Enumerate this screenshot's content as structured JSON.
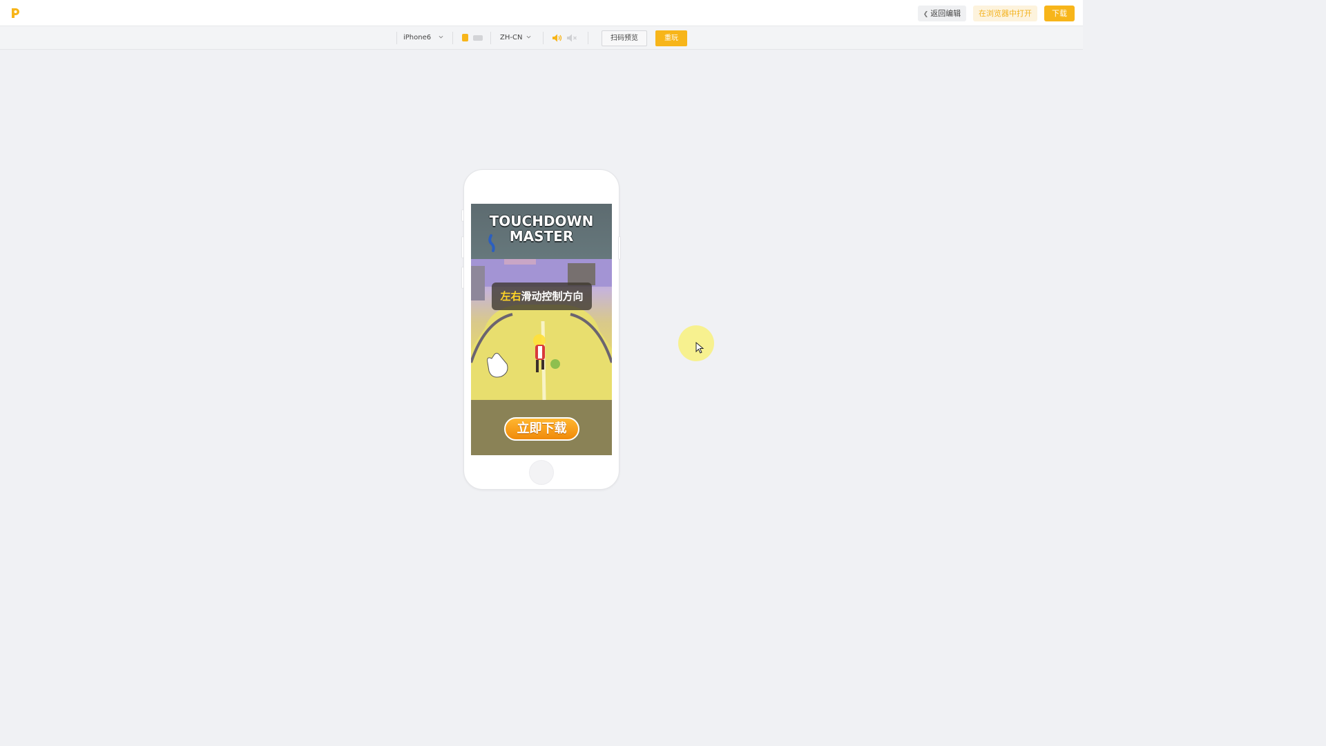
{
  "header": {
    "logo_letter": "P",
    "back_label": "返回编辑",
    "open_in_browser_label": "在浏览器中打开",
    "download_label": "下载"
  },
  "toolbar": {
    "device_select": "iPhone6",
    "language_select": "ZH-CN",
    "scan_preview_label": "扫码预览",
    "replay_label": "重玩",
    "orientation_icons": [
      "portrait-icon",
      "landscape-icon"
    ],
    "sound_icons": [
      "volume-on-icon",
      "volume-mute-icon"
    ]
  },
  "preview": {
    "game_title_line1": "TOUCHDOWN",
    "game_title_line2": "MASTER",
    "hint_highlight": "左右",
    "hint_rest": "滑动控制方向",
    "cta_label": "立即下载"
  },
  "colors": {
    "accent": "#f7b51a",
    "accent_light": "#fdf3dd",
    "background": "#f0f1f4"
  }
}
